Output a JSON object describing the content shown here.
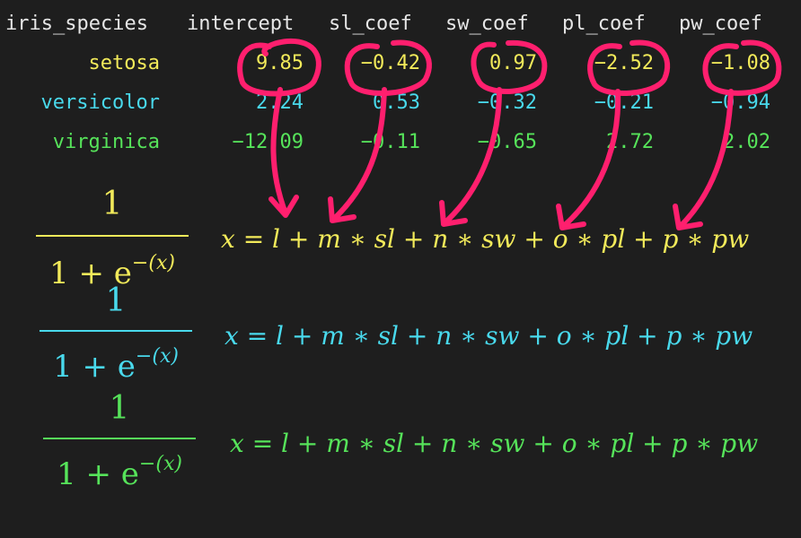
{
  "table": {
    "headers": [
      "iris_species",
      "intercept",
      "sl_coef",
      "sw_coef",
      "pl_coef",
      "pw_coef"
    ],
    "rows": [
      {
        "species": "setosa",
        "values": [
          "9.85",
          "−0.42",
          "0.97",
          "−2.52",
          "−1.08"
        ]
      },
      {
        "species": "versicolor",
        "values": [
          "2.24",
          "0.53",
          "−0.32",
          "−0.21",
          "−0.94"
        ]
      },
      {
        "species": "virginica",
        "values": [
          "−12.09",
          "−0.11",
          "−0.65",
          "2.72",
          "2.02"
        ]
      }
    ]
  },
  "formulas": [
    {
      "numerator": "1",
      "denominator_base": "1 + e",
      "exponent": "−(x)",
      "equation": "x = l + m ∗ sl + n ∗ sw + o ∗ pl + p ∗ pw",
      "color": "#f2ea5a"
    },
    {
      "numerator": "1",
      "denominator_base": "1 + e",
      "exponent": "−(x)",
      "equation": "x = l + m ∗ sl + n ∗ sw + o ∗ pl + p ∗ pw",
      "color": "#49d9ec"
    },
    {
      "numerator": "1",
      "denominator_base": "1 + e",
      "exponent": "−(x)",
      "equation": "x = l + m ∗ sl + n ∗ sw + o ∗ pl + p ∗ pw",
      "color": "#56e35a"
    }
  ],
  "colors": {
    "background": "#1e1e1e",
    "header": "#e6e6e6",
    "setosa": "#f2ea5a",
    "versicolor": "#49d9ec",
    "virginica": "#56e35a",
    "annotation": "#ff1f6e"
  }
}
